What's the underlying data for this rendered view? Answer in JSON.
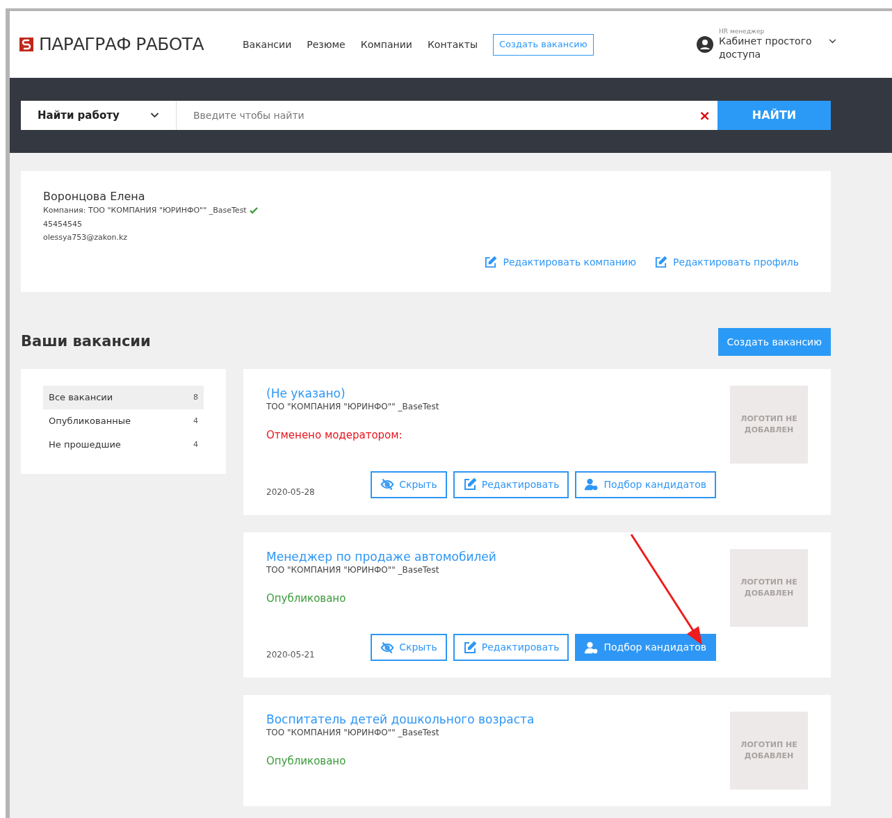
{
  "header": {
    "logo_text": "ПАРАГРАФ РАБОТА",
    "nav": [
      "Вакансии",
      "Резюме",
      "Компании",
      "Контакты"
    ],
    "create_button": "Создать вакансию",
    "user": {
      "role": "HR менеджер",
      "name": "Кабинет простого доступа"
    }
  },
  "search": {
    "category": "Найти работу",
    "placeholder": "Введите чтобы найти",
    "clear": "×",
    "button": "НАЙТИ"
  },
  "profile": {
    "name": "Воронцова Елена",
    "company": "Компания: ТОО \"КОМПАНИЯ \"ЮРИНФО\"\" _BaseTest",
    "verified": true,
    "phone": "45454545",
    "email": "olessya753@zakon.kz",
    "actions": [
      "Редактировать компанию",
      "Редактировать профиль"
    ]
  },
  "vacancies_section": {
    "title": "Ваши вакансии",
    "create_button": "Создать вакансию"
  },
  "filters": [
    {
      "label": "Все вакансии",
      "count": "8",
      "selected": true
    },
    {
      "label": "Опубликованные",
      "count": "4",
      "selected": false
    },
    {
      "label": "Не прошедшие",
      "count": "4",
      "selected": false
    }
  ],
  "vacancies": [
    {
      "title": "(Не указано)",
      "company": "ТОО \"КОМПАНИЯ \"ЮРИНФО\"\" _BaseTest",
      "status": "Отменено модератором:",
      "kind": "cancelled",
      "logo": "ЛОГОТИП НЕ ДОБАВЛЕН",
      "date": "2020-05-28",
      "buttons": [
        {
          "label": "Скрыть",
          "kind": "hide",
          "highlighted": false
        },
        {
          "label": "Редактировать",
          "kind": "edit",
          "highlighted": false
        },
        {
          "label": "Подбор кандидатов",
          "kind": "candidates",
          "highlighted": false
        }
      ]
    },
    {
      "title": "Менеджер по продаже автомобилей",
      "company": "ТОО \"КОМПАНИЯ \"ЮРИНФО\"\" _BaseTest",
      "status": "Опубликовано",
      "kind": "published",
      "logo": "ЛОГОТИП НЕ ДОБАВЛЕН",
      "date": "2020-05-21",
      "buttons": [
        {
          "label": "Скрыть",
          "kind": "hide",
          "highlighted": false
        },
        {
          "label": "Редактировать",
          "kind": "edit",
          "highlighted": false
        },
        {
          "label": "Подбор кандидатов",
          "kind": "candidates",
          "highlighted": true
        }
      ]
    },
    {
      "title": "Воспитатель детей дошкольного возраста",
      "company": "ТОО \"КОМПАНИЯ \"ЮРИНФО\"\" _BaseTest",
      "status": "Опубликовано",
      "kind": "published",
      "logo": "ЛОГОТИП НЕ ДОБАВЛЕН"
    }
  ]
}
